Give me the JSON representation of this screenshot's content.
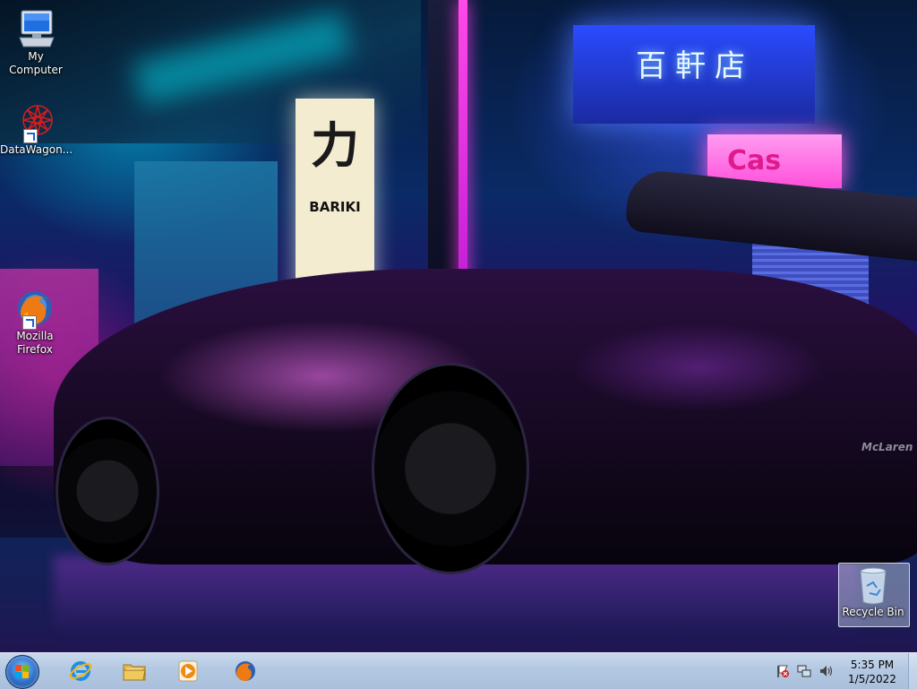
{
  "desktop": {
    "wallpaper": {
      "shop_sign_char": "力",
      "shop_sign_text": "BARIKI",
      "neon_sign_text": "百軒店",
      "neon_pink_text": "Cas",
      "car_brand": "McLaren"
    },
    "icons": [
      {
        "label": "My Computer",
        "icon": "computer-icon"
      },
      {
        "label": "DataWagon...",
        "icon": "datawagon-icon"
      },
      {
        "label": "Mozilla Firefox",
        "icon": "firefox-icon"
      },
      {
        "label": "Recycle Bin",
        "icon": "recycle-bin-icon"
      }
    ]
  },
  "taskbar": {
    "start": {
      "icon": "windows-start-icon"
    },
    "pinned": [
      {
        "name": "Internet Explorer",
        "icon": "internet-explorer-icon"
      },
      {
        "name": "Windows Explorer",
        "icon": "folder-icon"
      },
      {
        "name": "Windows Media Player",
        "icon": "media-player-icon"
      },
      {
        "name": "Mozilla Firefox",
        "icon": "firefox-icon"
      }
    ],
    "tray": {
      "icons": [
        "action-center-flag-icon",
        "network-icon",
        "volume-icon"
      ],
      "time": "5:35 PM",
      "date": "1/5/2022"
    }
  },
  "colors": {
    "taskbar": "#b3c8e2",
    "neon_pink": "#ff49e8",
    "neon_blue": "#2b4bff"
  }
}
